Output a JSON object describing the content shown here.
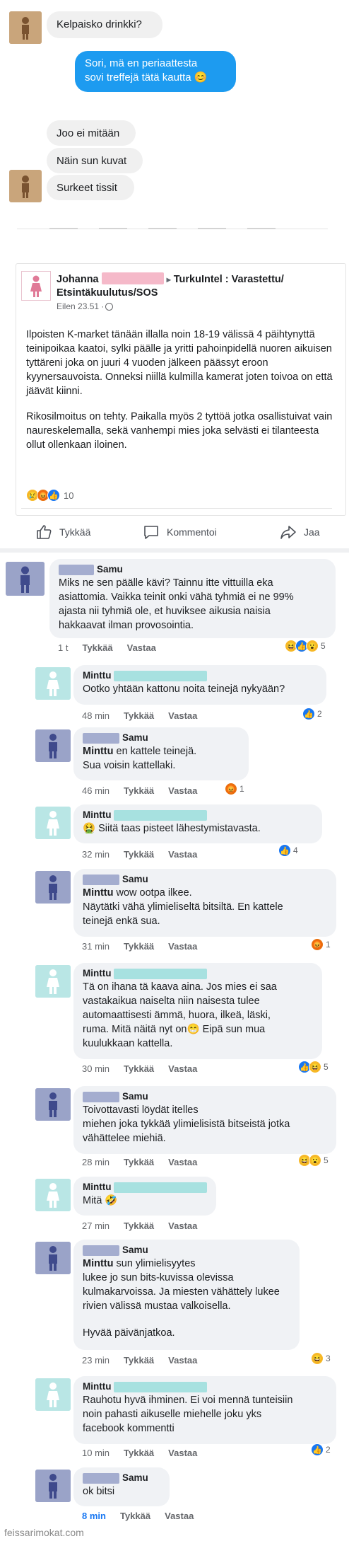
{
  "chat": {
    "messages": [
      {
        "from": "other",
        "text": "Kelpaisko drinkki?"
      },
      {
        "from": "me",
        "text_lines": [
          "Sori, mä en periaattesta",
          "sovi treffejä tätä kautta 😊"
        ]
      },
      {
        "from": "other",
        "text": "Joo ei mitään"
      },
      {
        "from": "other",
        "text": "Näin sun kuvat"
      },
      {
        "from": "other",
        "text": "Surkeet tissit"
      }
    ]
  },
  "post": {
    "author_first": "Johanna",
    "group_arrow": "▸",
    "group_line1": "TurkuIntel : Varastettu/",
    "group_line2": "Etsintäkuulutus/SOS",
    "time": "Eilen 23.51 · ",
    "body_p1": "Ilpoisten K-market tänään illalla noin 18-19 välissä 4 päihtynyttä teinipoikaa kaatoi, sylki päälle ja yritti pahoinpidellä nuoren aikuisen tyttäreni joka on juuri 4 vuoden jälkeen päässyt eroon kyynersauvoista. Onneksi niillä kulmilla kamerat joten toivoa on että jäävät kiinni.",
    "body_p2": "Rikosilmoitus on tehty. Paikalla myös 2 tyttöä jotka osallistuivat vain naureskelemalla, sekä vanhempi mies joka selvästi ei tilanteesta ollut ollenkaan iloinen.",
    "reaction_count": "10",
    "actions": {
      "like": "Tykkää",
      "comment": "Kommentoi",
      "share": "Jaa"
    }
  },
  "comments": [
    {
      "name": "Samu",
      "lines": [
        "Miks ne sen päälle kävi? Tainnu itte vittuilla eka",
        "asiattomia. Vaikka teinit onki vähä tyhmiä ei ne 99%",
        "ajasta nii tyhmiä ole, et huviksee aikusia naisia",
        "hakkaavat ilman provosointia."
      ],
      "time": "1 t",
      "like": "Tykkää",
      "reply": "Vastaa",
      "react_count": "5"
    },
    {
      "name": "Minttu",
      "lines": [
        "Ootko yhtään kattonu noita teinejä nykyään?"
      ],
      "time": "48 min",
      "like": "Tykkää",
      "reply": "Vastaa",
      "react_count": "2"
    },
    {
      "name": "Samu",
      "mention": "Minttu",
      "lines": [
        " en kattele teinejä.",
        "Sua voisin kattellaki."
      ],
      "time": "46 min",
      "like": "Tykkää",
      "reply": "Vastaa",
      "react_count": "1"
    },
    {
      "name": "Minttu",
      "lines": [
        "🤮 Siitä taas pisteet lähestymistavasta."
      ],
      "time": "32 min",
      "like": "Tykkää",
      "reply": "Vastaa",
      "react_count": "4"
    },
    {
      "name": "Samu",
      "mention": "Minttu",
      "lines": [
        " wow ootpa ilkee.",
        "Näytätki vähä ylimieliseltä bitsiltä. En kattele",
        "teinejä enkä sua."
      ],
      "time": "31 min",
      "like": "Tykkää",
      "reply": "Vastaa",
      "react_count": "1"
    },
    {
      "name": "Minttu",
      "lines": [
        "Tä on ihana tä kaava aina. Jos mies ei saa",
        "vastakaikua naiselta niin naisesta tulee",
        "automaattisesti ämmä, huora, ilkeä, läski,",
        "ruma. Mitä näitä nyt on😁 Eipä sun mua",
        "kuulukkaan kattella."
      ],
      "time": "30 min",
      "like": "Tykkää",
      "reply": "Vastaa",
      "react_count": "5"
    },
    {
      "name": "Samu",
      "lines": [
        "Toivottavasti löydät itelles",
        "miehen joka tykkää ylimielisistä bitseistä jotka",
        "vähättelee miehiä."
      ],
      "time": "28 min",
      "like": "Tykkää",
      "reply": "Vastaa",
      "react_count": "5"
    },
    {
      "name": "Minttu",
      "lines": [
        "Mitä 🤣"
      ],
      "time": "27 min",
      "like": "Tykkää",
      "reply": "Vastaa",
      "react_count": ""
    },
    {
      "name": "Samu",
      "mention": "Minttu",
      "lines": [
        " sun ylimielisyytes",
        "lukee jo sun bits-kuvissa olevissa",
        "kulmakarvoissa. Ja miesten vähättely lukee",
        "rivien välissä mustaa valkoisella.",
        "",
        "Hyvää päivänjatkoa."
      ],
      "time": "23 min",
      "like": "Tykkää",
      "reply": "Vastaa",
      "react_count": "3"
    },
    {
      "name": "Minttu",
      "lines": [
        "Rauhotu hyvä ihminen. Ei voi mennä tunteisiin",
        "noin pahasti aikuselle miehelle joku yks",
        "facebook kommentti"
      ],
      "time": "10 min",
      "like": "Tykkää",
      "reply": "Vastaa",
      "react_count": "2"
    },
    {
      "name": "Samu",
      "lines": [
        "ok bitsi"
      ],
      "time": "8 min",
      "like": "Tykkää",
      "reply": "Vastaa",
      "react_count": ""
    }
  ],
  "watermark": "feissarimokat.com",
  "colors": {
    "me_bubble": "#1d9bf0",
    "link_blue": "#1877f2"
  }
}
